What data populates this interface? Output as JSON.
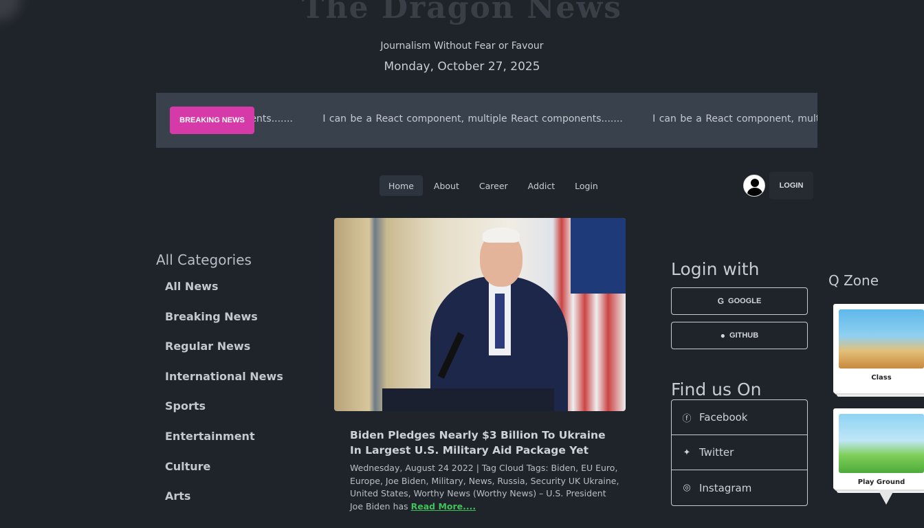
{
  "header": {
    "masthead": "The Dragon News",
    "tagline": "Journalism Without Fear or Favour",
    "date": "Monday, October 27, 2025"
  },
  "ticker": {
    "badge": "BREAKING NEWS",
    "items": [
      "onents.......",
      "I can be a React component, multiple React components.......",
      "I can be a React component, multipl"
    ]
  },
  "nav": {
    "items": [
      "Home",
      "About",
      "Career",
      "Addict",
      "Login"
    ],
    "login_button": "LOGIN"
  },
  "categories": {
    "heading": "All Categories",
    "items": [
      "All News",
      "Breaking News",
      "Regular News",
      "International News",
      "Sports",
      "Entertainment",
      "Culture",
      "Arts"
    ]
  },
  "article": {
    "title": "Biden Pledges Nearly $3 Billion To Ukraine In Largest U.S. Military Aid Package Yet",
    "excerpt": "Wednesday, August 24 2022 | Tag Cloud Tags: Biden, EU Euro, Europe, Joe Biden, Military, News, Russia, Security UK Ukraine, United States, Worthy News (Worthy News) – U.S. President Joe Biden has ",
    "read_more": "Read More...."
  },
  "login_with": {
    "heading": "Login with",
    "google": "GOOGLE",
    "github": "GITHUB"
  },
  "find_us": {
    "heading": "Find us On",
    "items": [
      "Facebook",
      "Twitter",
      "Instagram"
    ]
  },
  "qzone": {
    "heading": "Q Zone",
    "cards": [
      "Class",
      "Play Ground"
    ]
  },
  "colors": {
    "background": "#1f232a",
    "breaking_badge": "#d63aa8",
    "read_more": "#3fc25a"
  }
}
